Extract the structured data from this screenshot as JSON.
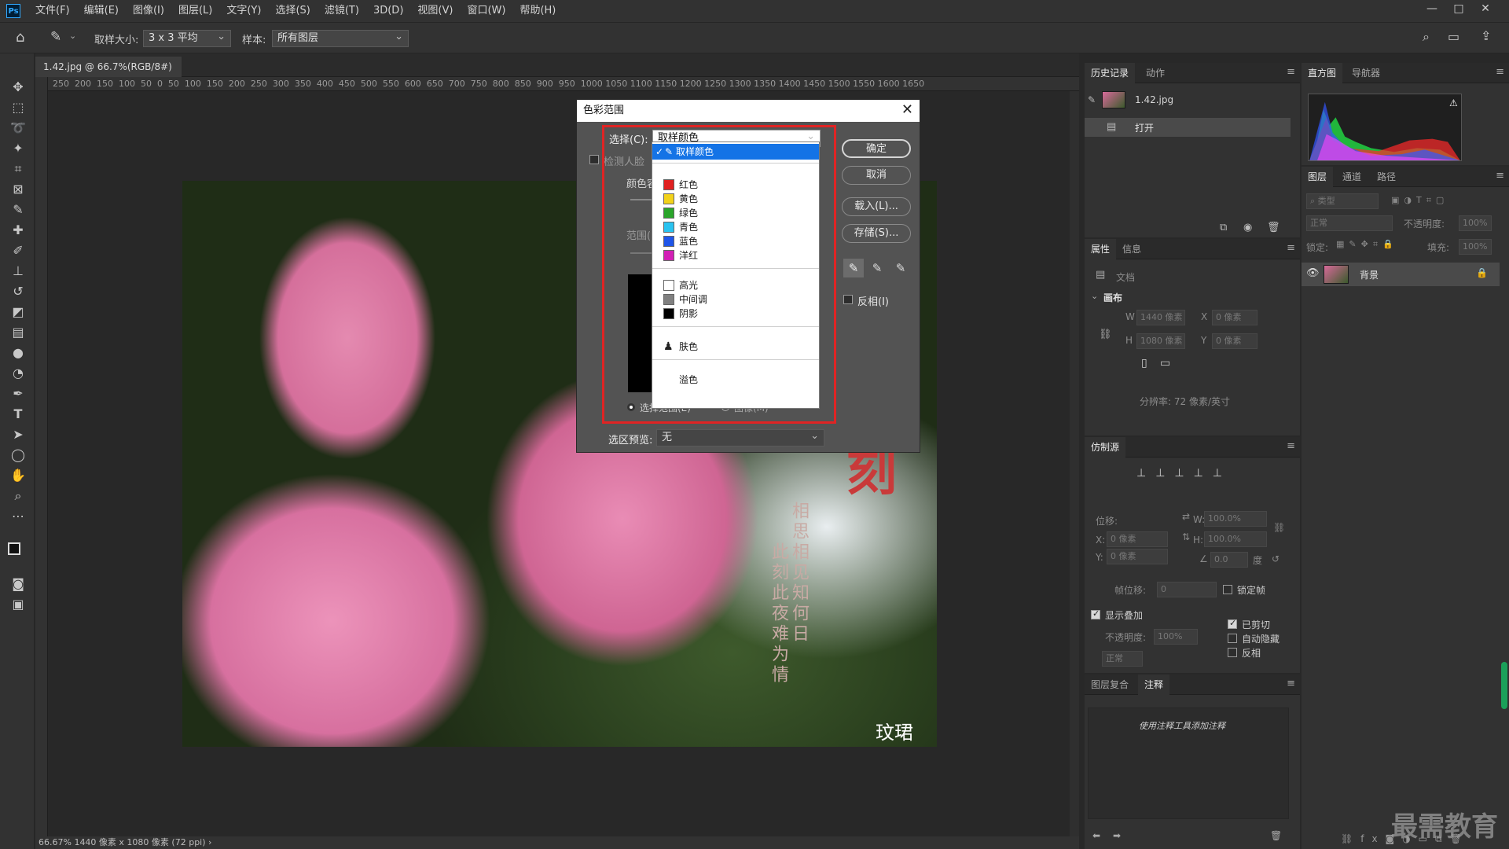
{
  "app": {
    "logo": "Ps"
  },
  "menu": [
    "文件(F)",
    "编辑(E)",
    "图像(I)",
    "图层(L)",
    "文字(Y)",
    "选择(S)",
    "滤镜(T)",
    "3D(D)",
    "视图(V)",
    "窗口(W)",
    "帮助(H)"
  ],
  "window_controls": {
    "minimize": "—",
    "maximize": "□",
    "close": "✕"
  },
  "options": {
    "sample_size_label": "取样大小:",
    "sample_size_value": "3 x 3 平均",
    "sample_label": "样本:",
    "sample_value": "所有图层"
  },
  "document": {
    "tab_title": "1.42.jpg @ 66.7%(RGB/8#)",
    "tab_close": "×",
    "ruler_ticks": "250  200  150  100  50  0  50  100  150  200  250  300  350  400  450  500  550  600  650  700  750  800  850  900  950  1000 1050 1100 1150 1200 1250 1300 1350 1400 1450 1500 1550 1600 1650",
    "status": "66.67%   1440 像素 x 1080 像素 (72 ppi)   ›",
    "poem_col1": "相思相见知何日",
    "poem_col2": "此刻此夜难为情",
    "stamp_char": "刻",
    "signature": "玟珺"
  },
  "dialog": {
    "title": "色彩范围",
    "close": "✕",
    "select_label": "选择(C):",
    "select_value": "取样颜色",
    "detect_faces": "检测人脸",
    "color_label": "颜色容",
    "range_label": "范围(",
    "ok": "确定",
    "cancel": "取消",
    "load": "载入(L)...",
    "save": "存储(S)...",
    "invert": "反相(I)",
    "radio_selection": "选择范围(E)",
    "radio_image": "图像(M)",
    "preview_label": "选区预览:",
    "preview_value": "无"
  },
  "dropdown": {
    "items": [
      {
        "label": "取样颜色",
        "type": "sampled",
        "selected": true
      },
      {
        "label": "红色",
        "color": "#e02020"
      },
      {
        "label": "黄色",
        "color": "#f2d21b"
      },
      {
        "label": "绿色",
        "color": "#2aa52a"
      },
      {
        "label": "青色",
        "color": "#29c3f0"
      },
      {
        "label": "蓝色",
        "color": "#1f55e8"
      },
      {
        "label": "洋红",
        "color": "#d21fb5"
      },
      {
        "label": "高光",
        "color": "#ffffff"
      },
      {
        "label": "中间调",
        "color": "#808080"
      },
      {
        "label": "阴影",
        "color": "#000000"
      },
      {
        "label": "肤色",
        "type": "skin"
      },
      {
        "label": "溢色",
        "type": "outofgamut"
      }
    ]
  },
  "history_panel": {
    "tabs": [
      "历史记录",
      "动作"
    ],
    "snapshot": "1.42.jpg",
    "step": "打开"
  },
  "histogram_panel": {
    "tabs": [
      "直方图",
      "导航器"
    ]
  },
  "properties_panel": {
    "tabs": [
      "属性",
      "信息"
    ],
    "doc_label": "文档",
    "section": "画布",
    "w_label": "W",
    "w_value": "1440 像素",
    "h_label": "H",
    "h_value": "1080 像素",
    "x_label": "X",
    "x_value": "0 像素",
    "y_label": "Y",
    "y_value": "0 像素",
    "resolution": "分辨率: 72 像素/英寸"
  },
  "layers_panel": {
    "tabs": [
      "图层",
      "通道",
      "路径"
    ],
    "filter": "类型",
    "blend_mode": "正常",
    "opacity_label": "不透明度:",
    "opacity_value": "100%",
    "lock_label": "锁定:",
    "fill_label": "填充:",
    "fill_value": "100%",
    "layer_name": "背景"
  },
  "clone_panel": {
    "title": "仿制源",
    "offset_label": "位移:",
    "x_label": "X:",
    "x_value": "0 像素",
    "y_label": "Y:",
    "y_value": "0 像素",
    "w_label": "W:",
    "w_value": "100.0%",
    "h_label": "H:",
    "h_value": "100.0%",
    "angle_value": "0.0",
    "angle_unit": "度",
    "frame_offset_label": "帧位移:",
    "frame_offset_value": "0",
    "lock_frame": "锁定帧",
    "show_overlay": "显示叠加",
    "overlay_opacity_label": "不透明度:",
    "overlay_opacity_value": "100%",
    "clipped": "已剪切",
    "auto_hide": "自动隐藏",
    "invert": "反相",
    "mode": "正常"
  },
  "notes_panel": {
    "tabs": [
      "图层复合",
      "注释"
    ],
    "hint": "使用注释工具添加注释"
  },
  "watermark": "最需教育"
}
